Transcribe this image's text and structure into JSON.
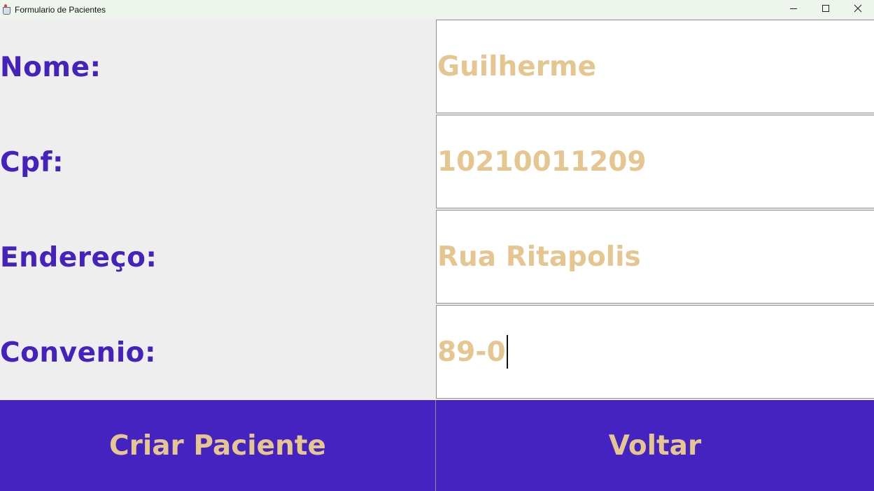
{
  "window": {
    "title": "Formulario de Pacientes",
    "controls": {
      "minimize_icon": "minimize-icon",
      "maximize_icon": "maximize-icon",
      "close_icon": "close-icon"
    }
  },
  "form": {
    "fields": [
      {
        "label": "Nome:",
        "value": "Guilherme"
      },
      {
        "label": "Cpf:",
        "value": "10210011209"
      },
      {
        "label": "Endereço:",
        "value": "Rua Ritapolis"
      },
      {
        "label": "Convenio:",
        "value": "89-0"
      }
    ]
  },
  "actions": {
    "create_label": "Criar Paciente",
    "back_label": "Voltar"
  },
  "colors": {
    "label_text": "#4422bb",
    "value_text": "#e6c690",
    "button_bg": "#4523c1",
    "panel_bg": "#eeeeee",
    "titlebar_bg": "#eef5ec"
  }
}
